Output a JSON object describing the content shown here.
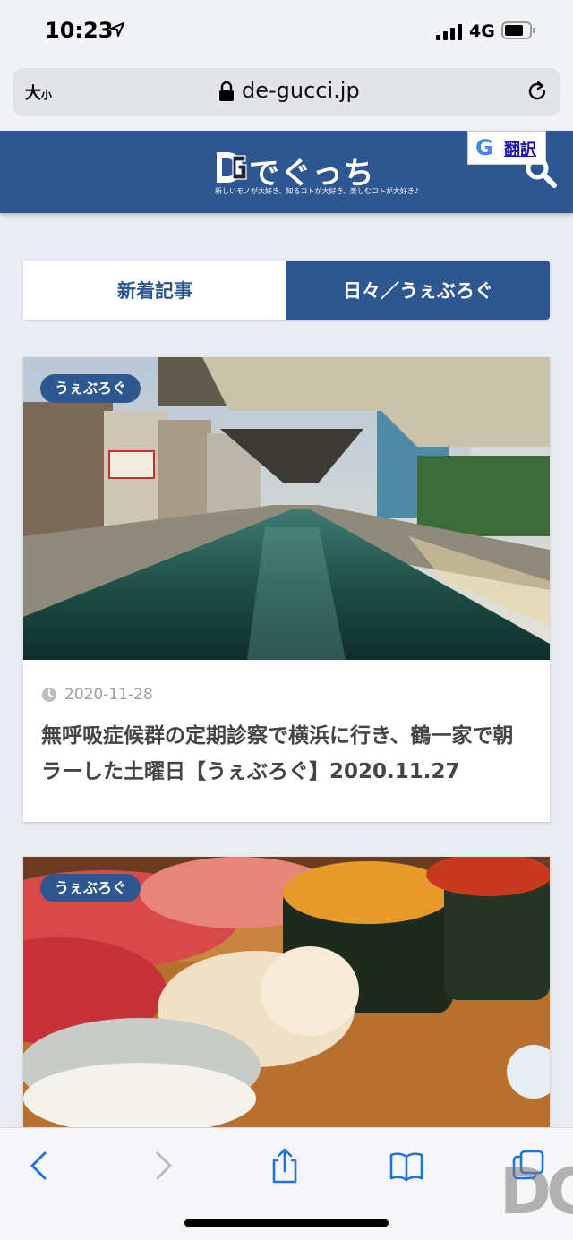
{
  "status": {
    "time": "10:23",
    "network": "4G"
  },
  "browser": {
    "text_size_big": "大",
    "text_size_small": "小",
    "domain": "de-gucci.jp"
  },
  "site": {
    "logo_text": "でぐっち",
    "tagline": "新しいモノが大好き、知るコトが大好き、楽しむコトが大好き♪",
    "translate_g": "G",
    "translate_label": "翻訳"
  },
  "tabs": [
    {
      "label": "新着記事",
      "active": false
    },
    {
      "label": "日々／うぇぶろぐ",
      "active": true
    }
  ],
  "articles": [
    {
      "category": "うぇぶろぐ",
      "date": "2020-11-28",
      "title": "無呼吸症候群の定期診察で横浜に行き、鶴一家で朝ラーした土曜日【うぇぶろぐ】2020.11.27"
    },
    {
      "category": "うぇぶろぐ"
    }
  ],
  "watermark": "DG",
  "colors": {
    "brand": "#2e5690",
    "ios_blue": "#1a73e8"
  }
}
